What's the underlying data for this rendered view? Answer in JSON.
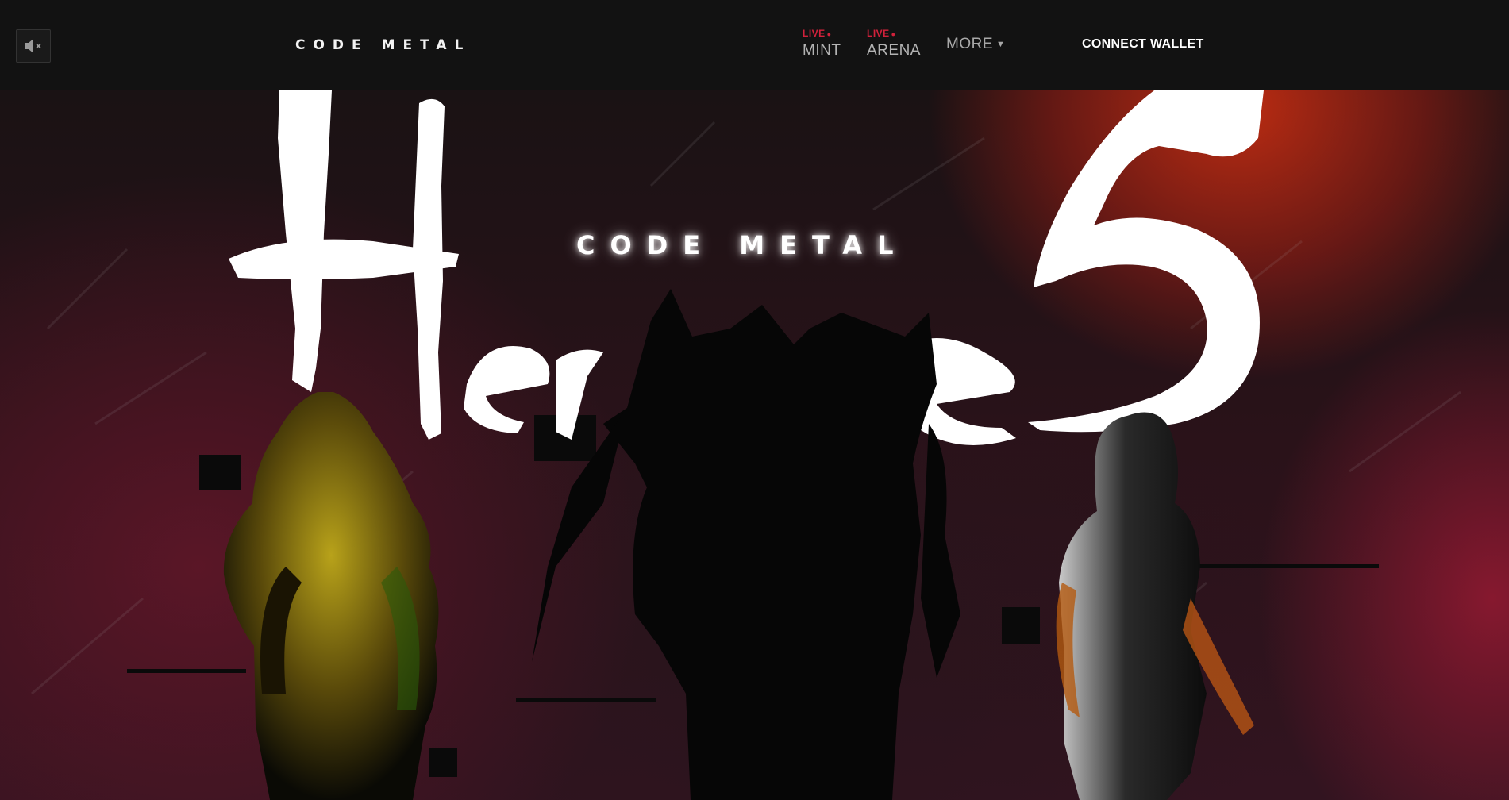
{
  "header": {
    "brand": "CODE METAL",
    "mute_icon": "speaker-muted-icon",
    "nav": [
      {
        "live_tag": "LIVE",
        "label": "MINT"
      },
      {
        "live_tag": "LIVE",
        "label": "ARENA"
      }
    ],
    "more_label": "MORE",
    "connect_label": "CONNECT WALLET",
    "live_color": "#d1213b"
  },
  "hero": {
    "brand": "CODE METAL",
    "script_title": "Heroes",
    "accent_colors": {
      "red_glow": "#c42d12",
      "crimson": "#96193a"
    }
  }
}
